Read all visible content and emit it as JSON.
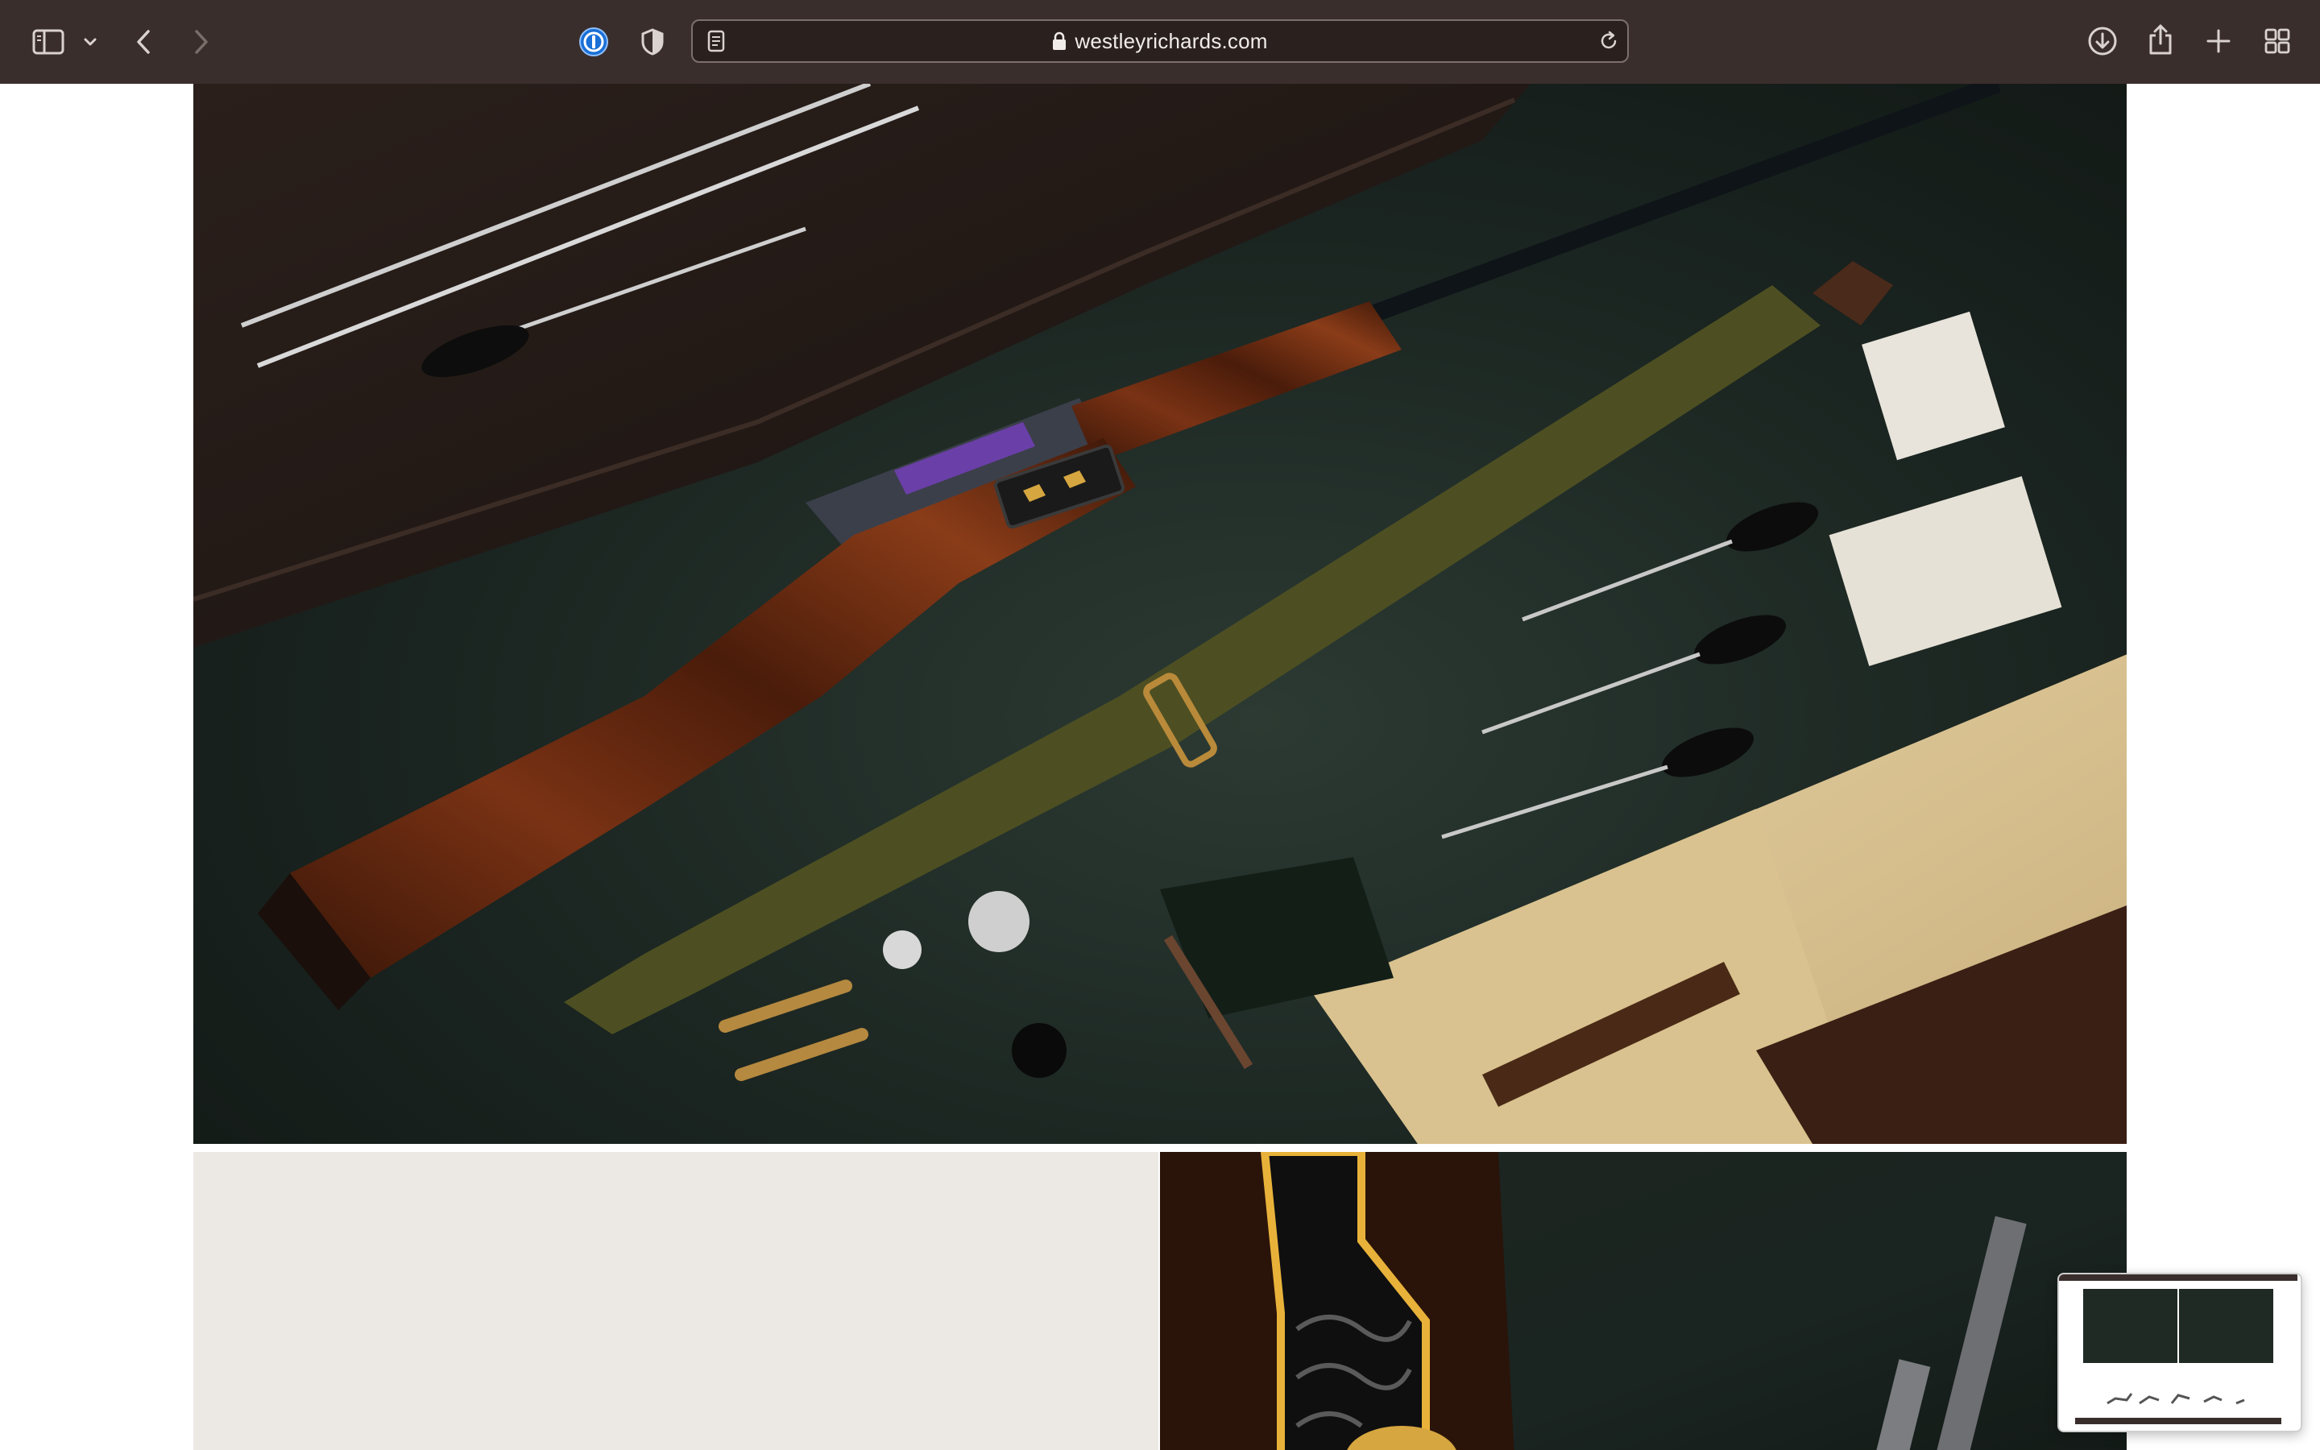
{
  "browser": {
    "url_display": "westleyrichards.com",
    "toolbar_color": "#3a2e2c",
    "icons": {
      "sidebar": "sidebar-icon",
      "back": "chevron-left-icon",
      "forward": "chevron-right-icon",
      "password_manager": "onepassword-icon",
      "privacy": "shield-icon",
      "reader": "reader-icon",
      "lock": "lock-icon",
      "reload": "reload-icon",
      "downloads": "download-icon",
      "share": "share-icon",
      "new_tab": "plus-icon",
      "tab_overview": "tab-grid-icon"
    }
  },
  "page": {
    "left_tile_color": "#ece8e3"
  }
}
